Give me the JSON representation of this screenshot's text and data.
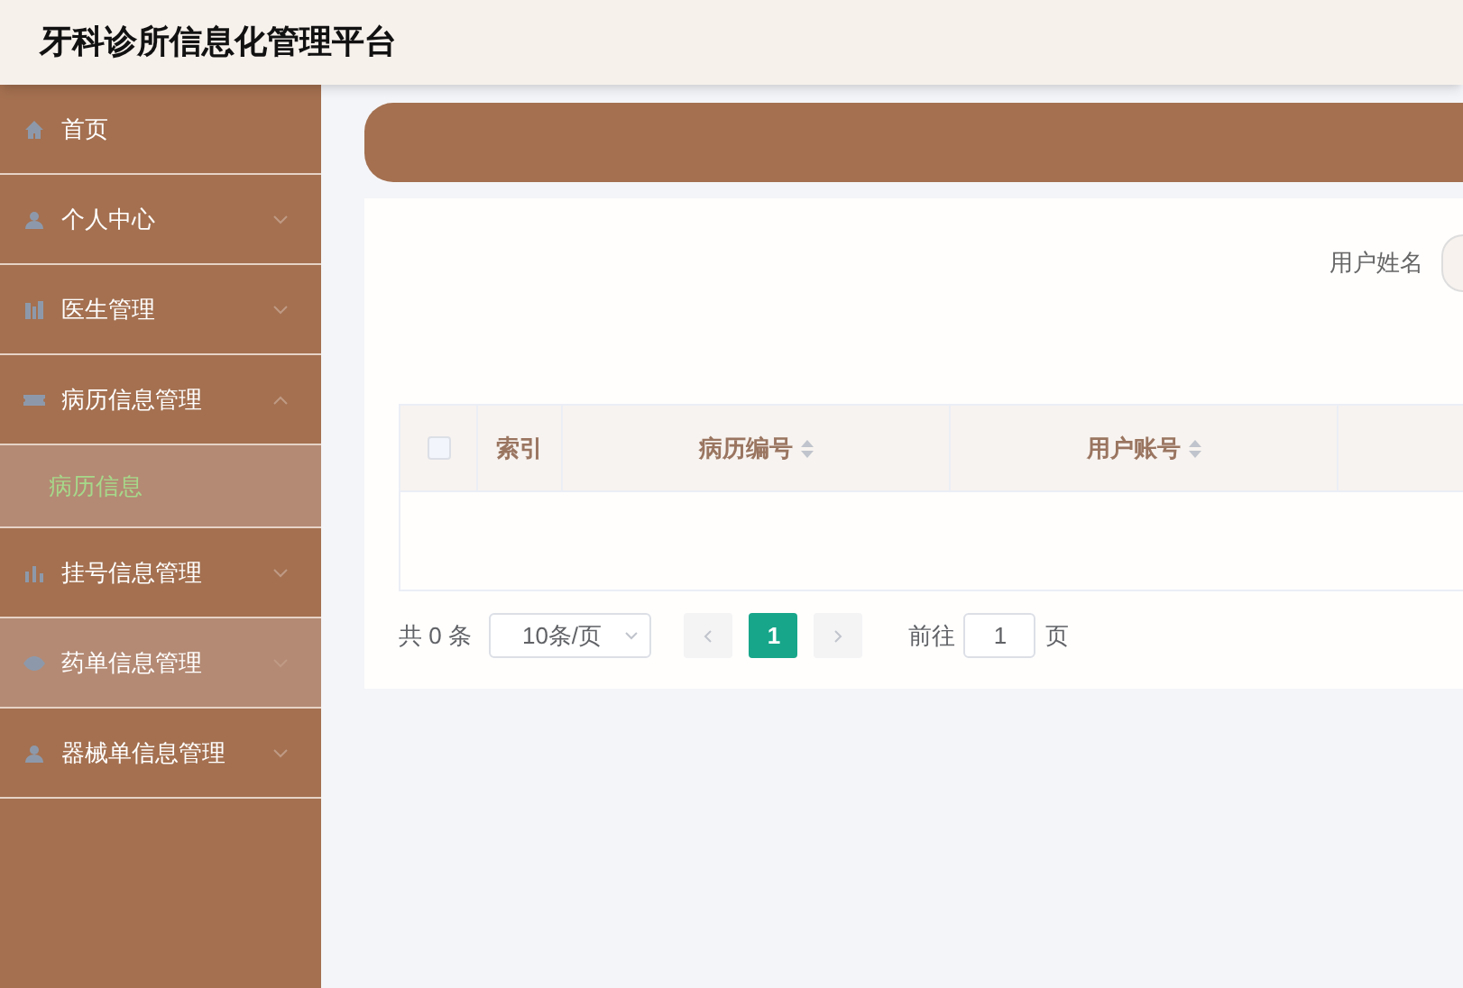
{
  "header": {
    "title": "牙科诊所信息化管理平台"
  },
  "sidebar": {
    "items": [
      {
        "label": "首页",
        "expandable": false,
        "hovered": false
      },
      {
        "label": "个人中心",
        "expandable": true,
        "expanded": false,
        "hovered": false
      },
      {
        "label": "医生管理",
        "expandable": true,
        "expanded": false,
        "hovered": false
      },
      {
        "label": "病历信息管理",
        "expandable": true,
        "expanded": true,
        "hovered": false,
        "children": [
          {
            "label": "病历信息",
            "selected": true
          }
        ]
      },
      {
        "label": "挂号信息管理",
        "expandable": true,
        "expanded": false,
        "hovered": false
      },
      {
        "label": "药单信息管理",
        "expandable": true,
        "expanded": false,
        "hovered": true
      },
      {
        "label": "器械单信息管理",
        "expandable": true,
        "expanded": false,
        "hovered": false
      }
    ]
  },
  "search": {
    "label": "用户姓名"
  },
  "table": {
    "columns": [
      {
        "label": "索引",
        "sortable": false
      },
      {
        "label": "病历编号",
        "sortable": true
      },
      {
        "label": "用户账号",
        "sortable": true
      }
    ],
    "select_all": {
      "checked": false
    }
  },
  "pagination": {
    "total": "共 0 条",
    "page_size": "10条/页",
    "pages": [
      {
        "label": "1",
        "selected": true
      }
    ],
    "goto_label": "前往",
    "goto_value": "1",
    "goto_suffix": "页"
  }
}
